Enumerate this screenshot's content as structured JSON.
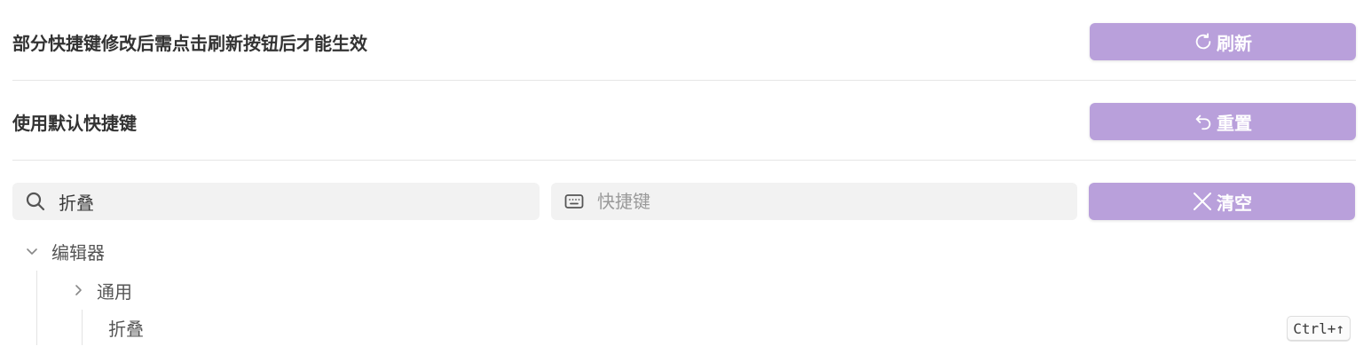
{
  "settings": {
    "refresh": {
      "title": "部分快捷键修改后需点击刷新按钮后才能生效",
      "button_label": "刷新",
      "icon": "refresh-icon"
    },
    "reset": {
      "title": "使用默认快捷键",
      "button_label": "重置",
      "icon": "undo-icon"
    }
  },
  "search": {
    "keyword_value": "折叠",
    "keyword_icon": "search-icon",
    "shortcut_placeholder": "快捷键",
    "shortcut_icon": "keyboard-icon",
    "clear_label": "清空",
    "clear_icon": "close-icon"
  },
  "tree": {
    "group": {
      "label": "编辑器",
      "expanded": true,
      "children": [
        {
          "label": "通用",
          "expanded": false
        },
        {
          "label": "折叠",
          "shortcut": "Ctrl+↑"
        }
      ]
    }
  },
  "colors": {
    "accent": "#b9a0db",
    "input_bg": "#f2f2f2",
    "divider": "#e6e6e6"
  }
}
